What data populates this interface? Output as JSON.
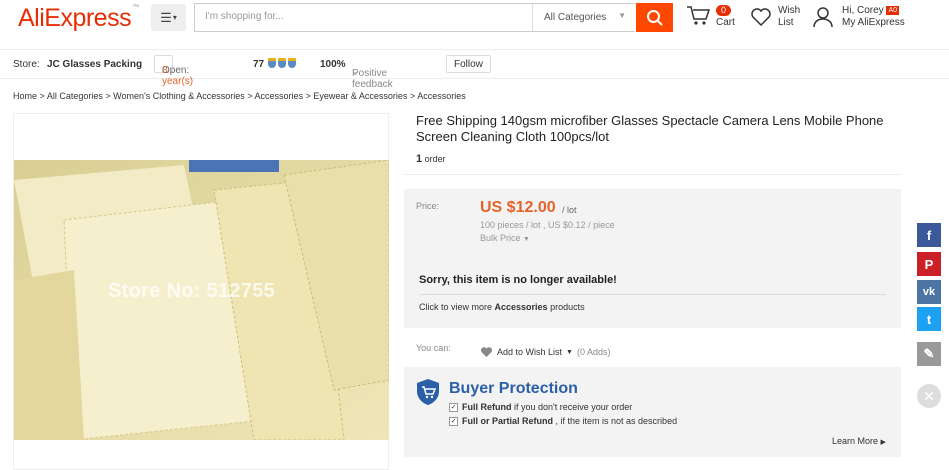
{
  "header": {
    "logo": "AliExpress",
    "logo_tm": "™",
    "search_placeholder": "I'm shopping for...",
    "search_category": "All Categories",
    "cart_label": "Cart",
    "cart_count": "0",
    "wish_line1": "Wish",
    "wish_line2": "List",
    "greeting": "Hi, Corey",
    "avatar_badge": "A0",
    "account_label": "My AliExpress"
  },
  "store_bar": {
    "store_label": "Store:",
    "store_name": "JC Glasses Packing",
    "open_label": "Open:",
    "open_years": "3 year(s)",
    "rating_score": "77",
    "feedback_percent": "100%",
    "feedback_label": "Positive feedback",
    "follow_label": "Follow"
  },
  "breadcrumb": [
    "Home",
    "All Categories",
    "Women's Clothing & Accessories",
    "Accessories",
    "Eyewear & Accessories",
    "Accessories"
  ],
  "breadcrumb_sep": ">",
  "product": {
    "watermark": "Store No: 512755",
    "title": "Free Shipping 140gsm microfiber Glasses Spectacle Camera Lens Mobile Phone Screen Cleaning Cloth 100pcs/lot",
    "order_count": "1",
    "order_label": "order",
    "price_label": "Price:",
    "price": "US $12.00",
    "price_unit": "/ lot",
    "bulk_info": "100 pieces / lot , US $0.12 / piece",
    "bulk_price_label": "Bulk Price",
    "unavailable_msg": "Sorry, this item is no longer available!",
    "more_prefix": "Click to view more ",
    "more_category": "Accessories",
    "more_suffix": " products",
    "you_can_label": "You can:",
    "add_wish_label": "Add to Wish List",
    "wish_count": "(0 Adds)"
  },
  "buyer_protection": {
    "title": "Buyer Protection",
    "line1_bold": "Full Refund",
    "line1_rest": " if you don't receive your order",
    "line2_bold": "Full or Partial Refund",
    "line2_rest": " , if the item is not as described",
    "learn_more": "Learn More"
  },
  "social": [
    {
      "name": "facebook",
      "glyph": "f",
      "color": "#3b5998"
    },
    {
      "name": "pinterest",
      "glyph": "P",
      "color": "#cb2027"
    },
    {
      "name": "vk",
      "glyph": "vk",
      "color": "#4c75a3"
    },
    {
      "name": "twitter",
      "glyph": "t",
      "color": "#1da1f2"
    },
    {
      "name": "edit",
      "glyph": "✎",
      "color": "#999999"
    }
  ],
  "colors": {
    "brand": "#e62e04",
    "search_button": "#ff4700",
    "price": "#e5632a",
    "protection": "#2b5fa7"
  }
}
